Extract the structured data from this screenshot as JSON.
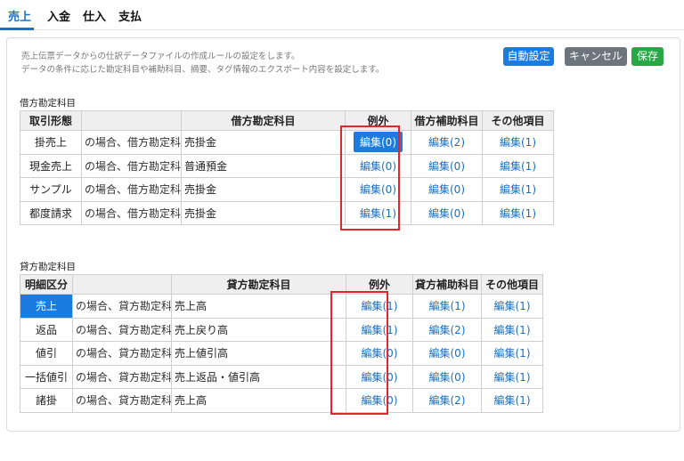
{
  "tabs": [
    "売上",
    "入金",
    "仕入",
    "支払"
  ],
  "description": [
    "売上伝票データからの仕訳データファイルの作成ルールの設定をします。",
    "データの条件に応じた勘定科目や補助科目、摘要、タグ情報のエクスポート内容を設定します。"
  ],
  "buttons": {
    "auto": "自動設定",
    "cancel": "キャンセル",
    "save": "保存"
  },
  "debit": {
    "section_label": "借方勘定科目",
    "headers": [
      "取引形態",
      "",
      "借方勘定科目",
      "例外",
      "借方補助科目",
      "その他項目"
    ],
    "rows": [
      {
        "cat": "掛売上",
        "note": "の場合、借方勘定科目は",
        "acct": "売掛金",
        "exc": "編集(0)",
        "sub": "編集(2)",
        "other": "編集(1)"
      },
      {
        "cat": "現金売上",
        "note": "の場合、借方勘定科目は",
        "acct": "普通預金",
        "exc": "編集(0)",
        "sub": "編集(0)",
        "other": "編集(1)"
      },
      {
        "cat": "サンプル",
        "note": "の場合、借方勘定科目は",
        "acct": "売掛金",
        "exc": "編集(0)",
        "sub": "編集(0)",
        "other": "編集(1)"
      },
      {
        "cat": "都度請求",
        "note": "の場合、借方勘定科目は",
        "acct": "売掛金",
        "exc": "編集(1)",
        "sub": "編集(0)",
        "other": "編集(1)"
      }
    ]
  },
  "credit": {
    "section_label": "貸方勘定科目",
    "headers": [
      "明細区分",
      "",
      "貸方勘定科目",
      "例外",
      "貸方補助科目",
      "その他項目"
    ],
    "rows": [
      {
        "cat": "売上",
        "note": "の場合、貸方勘定科目は",
        "acct": "売上高",
        "exc": "編集(1)",
        "sub": "編集(1)",
        "other": "編集(1)"
      },
      {
        "cat": "返品",
        "note": "の場合、貸方勘定科目は",
        "acct": "売上戻り高",
        "exc": "編集(1)",
        "sub": "編集(2)",
        "other": "編集(1)"
      },
      {
        "cat": "値引",
        "note": "の場合、貸方勘定科目は",
        "acct": "売上値引高",
        "exc": "編集(0)",
        "sub": "編集(0)",
        "other": "編集(1)"
      },
      {
        "cat": "一括値引",
        "note": "の場合、貸方勘定科目は",
        "acct": "売上返品・値引高",
        "exc": "編集(0)",
        "sub": "編集(0)",
        "other": "編集(1)"
      },
      {
        "cat": "諸掛",
        "note": "の場合、貸方勘定科目は",
        "acct": "売上高",
        "exc": "編集(0)",
        "sub": "編集(2)",
        "other": "編集(1)"
      }
    ]
  },
  "colors": {
    "accent": "#1a7ce0",
    "highlight_box": "#e2262b",
    "cancel": "#6c757d",
    "save": "#28a745"
  }
}
